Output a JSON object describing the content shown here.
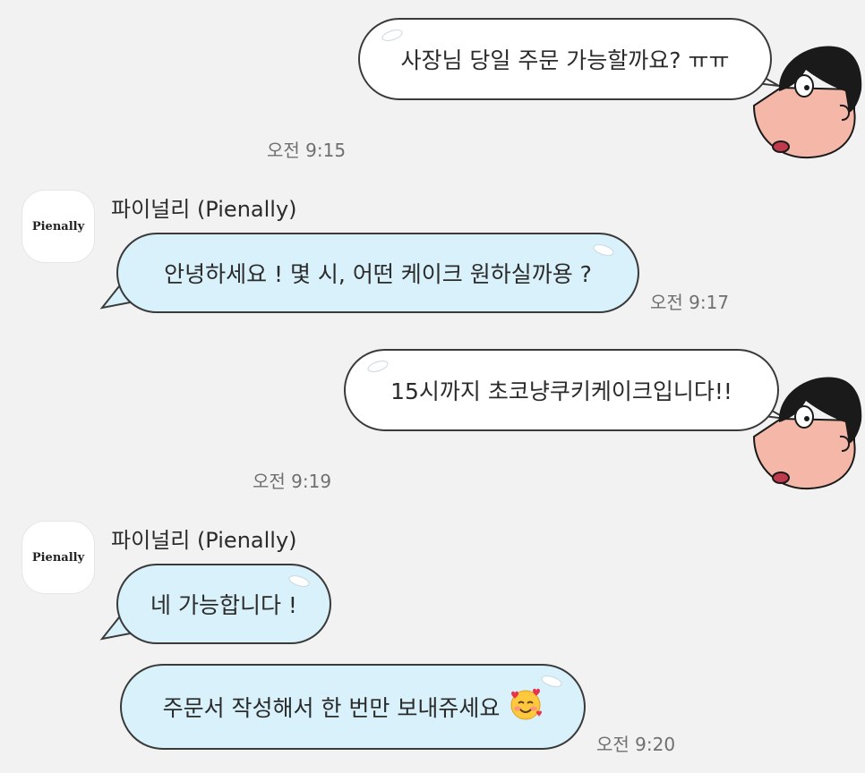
{
  "conversation": {
    "partner_name": "파이널리 (Pienally)",
    "partner_avatar_text": "Pienally",
    "messages": [
      {
        "from": "me",
        "text": "사장님 당일 주문 가능할까요? ㅠㅠ",
        "time": "오전 9:15"
      },
      {
        "from": "partner",
        "text": "안녕하세요 ! 몇 시, 어떤 케이크 원하실까용 ?",
        "time": "오전 9:17"
      },
      {
        "from": "me",
        "text": "15시까지 초코냥쿠키케이크입니다!!",
        "time": "오전 9:19"
      },
      {
        "from": "partner",
        "text": "네 가능합니다 !",
        "time": ""
      },
      {
        "from": "partner",
        "text": "주문서 작성해서 한 번만 보내쥬세요",
        "time": "오전 9:20",
        "emoji": "smiling-face-with-hearts"
      }
    ]
  },
  "colors": {
    "background": "#f2f2f2",
    "outgoing_bubble": "#ffffff",
    "incoming_bubble": "#d8f1fa",
    "bubble_border": "#3a3a3a",
    "avatar_skin": "#f5b8a8",
    "avatar_hair": "#1a1a1a"
  }
}
